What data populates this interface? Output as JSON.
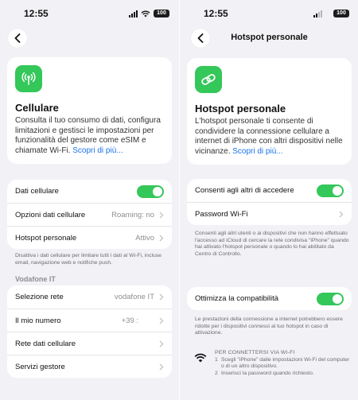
{
  "left": {
    "status": {
      "time": "12:55",
      "battery": "100"
    },
    "hero": {
      "title": "Cellulare",
      "description": "Consulta il tuo consumo di dati, configura limitazioni e gestisci le impostazioni per funzionalità del gestore come eSIM e chiamate Wi-Fi.",
      "link": "Scopri di più..."
    },
    "group1": {
      "mobile_data": "Dati cellulare",
      "options_label": "Opzioni dati cellulare",
      "options_value": "Roaming: no",
      "hotspot_label": "Hotspot personale",
      "hotspot_value": "Attivo"
    },
    "footnote": "Disattiva i dati cellulare per limitare tutti i dati al Wi-Fi, incluse email, navigazione web e notifiche push.",
    "section_header": "Vodafone IT",
    "group2": {
      "network_label": "Selezione rete",
      "network_value": "vodafone IT",
      "number_label": "Il mio numero",
      "number_value": "+39 :",
      "cellular_network": "Rete dati cellulare",
      "carrier_services": "Servizi gestore"
    }
  },
  "right": {
    "status": {
      "time": "12:55",
      "battery": "100"
    },
    "nav_title": "Hotspot personale",
    "hero": {
      "title": "Hotspot personale",
      "description": "L'hotspot personale ti consente di condividere la connessione cellulare a internet di iPhone con altri dispositivi nelle vicinanze.",
      "link": "Scopri di più..."
    },
    "group1": {
      "allow_label": "Consenti agli altri di accedere",
      "password_label": "Password Wi-Fi"
    },
    "footnote1": "Consenti agli altri utenti o ai dispositivi che non hanno effettuato l'accesso ad iCloud di cercare la rete condivisa \"iPhone\" quando hai attivato l'hotspot personale o quando lo hai abilitato da Centro di Controllo.",
    "group2": {
      "compat_label": "Ottimizza la compatibilità"
    },
    "footnote2": "Le prestazioni della connessione a internet potrebbero essere ridotte per i dispositivi connessi al tuo hotspot in caso di attivazione.",
    "connect": {
      "heading": "PER CONNETTERSI VIA WI-FI",
      "step1_num": "1",
      "step1": "Scegli \"iPhone\" dalle impostazioni Wi-Fi del computer o di un altro dispositivo.",
      "step2_num": "2",
      "step2": "Inserisci la password quando richiesto."
    }
  },
  "colors": {
    "accent_green": "#34c759",
    "link_blue": "#1a73e8",
    "background": "#f2f2f6"
  }
}
